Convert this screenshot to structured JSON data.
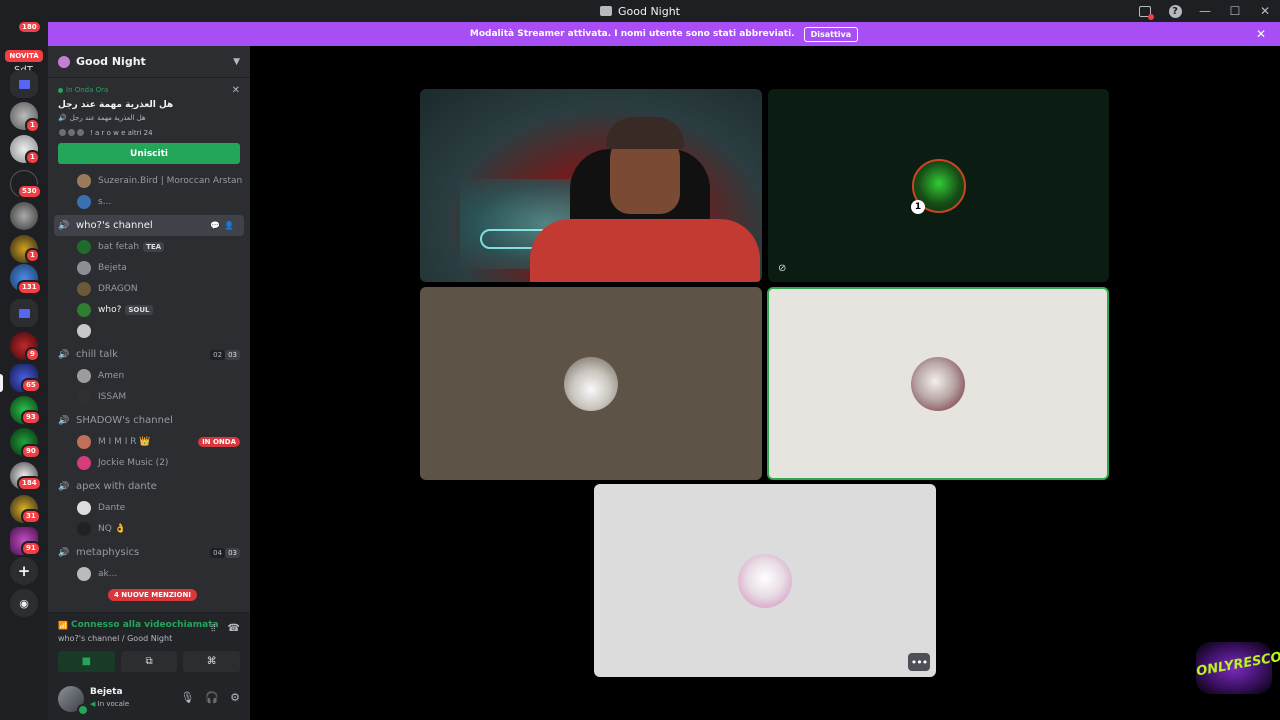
{
  "window": {
    "title": "Good Night"
  },
  "banner": {
    "text": "Modalità Streamer attivata. I nomi utente sono stati abbreviati.",
    "button": "Disattiva"
  },
  "guilds": {
    "novita_label": "NOVITÀ",
    "top_badge": "180",
    "sdt_label": "SdT",
    "badges": [
      "1",
      "1",
      "530",
      "1",
      "131",
      "9",
      "65",
      "93",
      "90",
      "184",
      "31",
      "91"
    ]
  },
  "sidebar": {
    "server_name": "Good Night",
    "stage": {
      "live_label": "In Onda Ora",
      "title": "هل العذرية مهمة عند رجل",
      "subtitle": "هل العذرية مهمة عند رجل",
      "people": "! a r o w e altri 24",
      "join_label": "Unisciti"
    },
    "stage_listeners": [
      {
        "name": "Suzerain.Bird | Moroccan Arstan",
        "color": "#9a7a5a"
      },
      {
        "name": "s...",
        "color": "#3a6fb0"
      }
    ],
    "channels": [
      {
        "name": "who?'s channel",
        "active": true,
        "users": [
          {
            "name": "bat fetah",
            "tag": "TEA",
            "color": "#1f6b2b"
          },
          {
            "name": "Bejeta",
            "color": "#8a8f96"
          },
          {
            "name": "DRAGON",
            "color": "#6b5a3a"
          },
          {
            "name": "who?",
            "tag": "SOUL",
            "color": "#2e7d32",
            "bright": true
          },
          {
            "name": "",
            "color": "#c8c8c8"
          }
        ]
      },
      {
        "name": "chill talk",
        "count_a": "02",
        "count_b": "03",
        "users": [
          {
            "name": "Amen",
            "color": "#9c9c9c"
          },
          {
            "name": "ISSAM",
            "color": "#303030"
          }
        ]
      },
      {
        "name": "SHADOW's channel",
        "users": [
          {
            "name": "M I M I R 👑",
            "crown": "👑",
            "live": "IN ONDA",
            "color": "#c0705a"
          },
          {
            "name": "Jockie Music (2)",
            "color": "#d23d7a"
          }
        ]
      },
      {
        "name": "apex with dante",
        "users": [
          {
            "name": "Dante",
            "color": "#ddd"
          },
          {
            "name": "NQ 👌",
            "color": "#222"
          }
        ]
      },
      {
        "name": "metaphysics",
        "count_a": "04",
        "count_b": "03",
        "users": [
          {
            "name": "ak...",
            "color": "#bbb"
          }
        ]
      }
    ],
    "mention_pill": "4 NUOVE MENZIONI",
    "voice": {
      "status": "Connesso alla videochiamata",
      "channel": "who?'s channel / Good Night"
    },
    "user": {
      "name": "Bejeta",
      "status": "In vocale"
    }
  },
  "stage": {
    "tiles": [
      {
        "kind": "camera"
      },
      {
        "kind": "avatar",
        "badge": "1"
      },
      {
        "kind": "avatar"
      },
      {
        "kind": "avatar",
        "speaking": true
      },
      {
        "kind": "avatar"
      }
    ],
    "watermark": "ONLYRESCO"
  },
  "colors": {
    "accent_purple": "#a74ef4",
    "green": "#23a55a",
    "red": "#f23f43",
    "sidebar_bg": "#2b2d31",
    "guild_bg": "#1e1f22"
  }
}
